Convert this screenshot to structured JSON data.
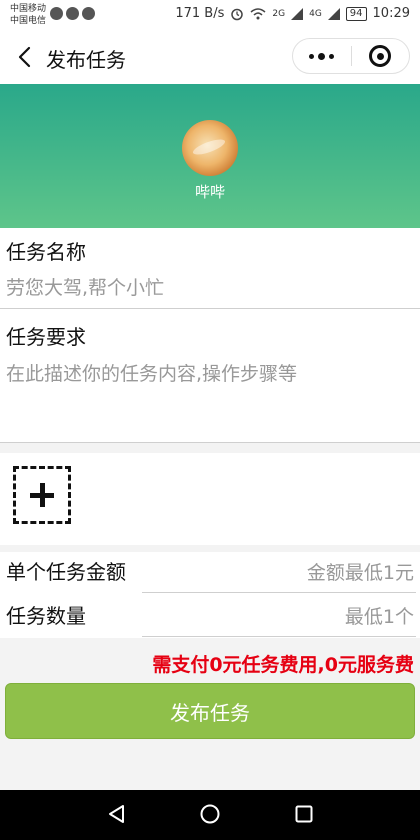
{
  "status_bar": {
    "carrier_1": "中国移动",
    "carrier_2": "中国电信",
    "speed": "171 B/s",
    "network_2g": "2G",
    "network_4g": "4G",
    "battery": "94",
    "time": "10:29"
  },
  "nav": {
    "title": "发布任务",
    "back_icon": "chevron-left-icon",
    "more_icon": "more-dots-icon",
    "close_icon": "target-circle-icon"
  },
  "profile": {
    "name": "哔哔",
    "avatar_icon": "bread-avatar"
  },
  "form": {
    "task_name_label": "任务名称",
    "task_name_placeholder": "劳您大驾,帮个小忙",
    "task_req_label": "任务要求",
    "task_req_placeholder": "在此描述你的任务内容,操作步骤等",
    "upload_icon": "add-image-icon",
    "amount_label": "单个任务金额",
    "amount_placeholder": "金额最低1元",
    "quantity_label": "任务数量",
    "quantity_placeholder": "最低1个",
    "fee_text": "需支付0元任务费用,0元服务费",
    "publish_label": "发布任务"
  },
  "colors": {
    "banner_top": "#2aa88a",
    "banner_bottom": "#5ec58a",
    "publish_button": "#8fc04a",
    "fee_text": "#e60012"
  },
  "system_nav": {
    "back_icon": "triangle-back-icon",
    "home_icon": "circle-home-icon",
    "recents_icon": "square-recents-icon"
  }
}
